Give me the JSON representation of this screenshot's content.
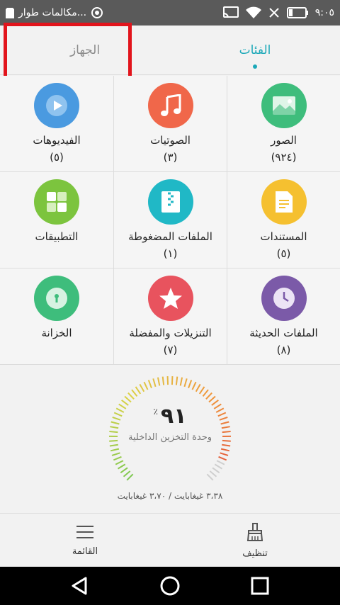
{
  "status_bar": {
    "notification_text": "مكالمات طوار...",
    "time": "٩:٠٥"
  },
  "tabs": {
    "device": "الجهاز",
    "categories": "الفئات"
  },
  "categories": [
    {
      "label": "الصور",
      "count": "(٩٢٤)",
      "color": "#3ebd7c",
      "icon": "image-icon"
    },
    {
      "label": "الصوتيات",
      "count": "(٣)",
      "color": "#f0674a",
      "icon": "music-icon"
    },
    {
      "label": "الفيديوهات",
      "count": "(٥)",
      "color": "#4a9ae0",
      "icon": "play-icon"
    },
    {
      "label": "المستندات",
      "count": "(٥)",
      "color": "#f5c030",
      "icon": "document-icon"
    },
    {
      "label": "الملفات المضغوطة",
      "count": "(١)",
      "color": "#20b8c6",
      "icon": "zip-icon"
    },
    {
      "label": "التطبيقات",
      "count": "",
      "color": "#7cc43e",
      "icon": "apps-icon"
    },
    {
      "label": "الملفات الحديثة",
      "count": "(٨)",
      "color": "#7b5aa8",
      "icon": "clock-icon"
    },
    {
      "label": "التنزيلات والمفضلة",
      "count": "(٧)",
      "color": "#e8535e",
      "icon": "star-icon"
    },
    {
      "label": "الخزانة",
      "count": "",
      "color": "#3ebd7c",
      "icon": "safe-icon"
    }
  ],
  "storage": {
    "percent": "٩١",
    "percent_sign": "٪",
    "percent_value": 91,
    "label": "وحدة التخزين الداخلية",
    "usage": "٣،٣٨ غيغابايت / ٣،٧٠ غيغابايت"
  },
  "toolbar": {
    "menu": "القائمة",
    "clean": "تنظيف"
  }
}
